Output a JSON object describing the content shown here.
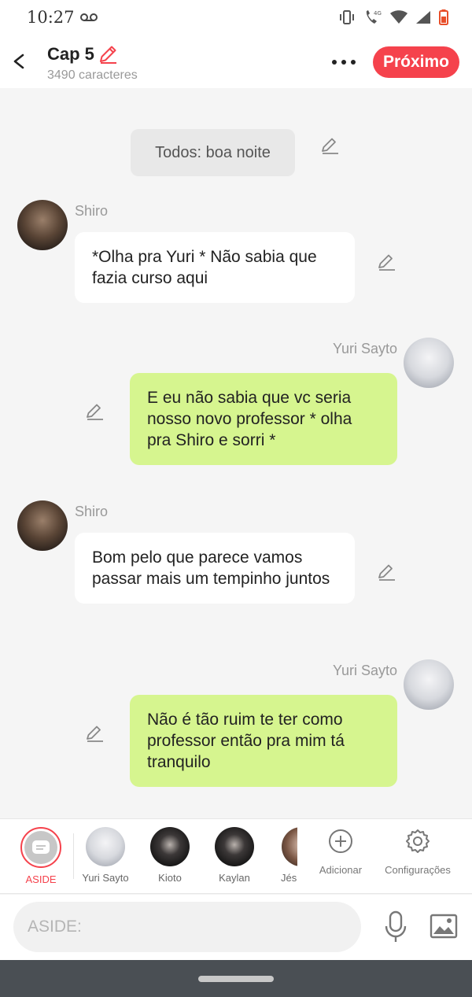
{
  "status_bar": {
    "time": "10:27",
    "network": "4G"
  },
  "header": {
    "title": "Cap 5",
    "char_count": "3490 caracteres",
    "next_label": "Próximo"
  },
  "messages": [
    {
      "type": "aside",
      "text": "Todos: boa noite"
    },
    {
      "type": "left",
      "sender": "Shiro",
      "text": "*Olha pra Yuri * Não sabia que fazia curso aqui"
    },
    {
      "type": "right",
      "sender": "Yuri Sayto",
      "text": "E eu não sabia que vc seria nosso novo professor * olha pra Shiro e sorri *"
    },
    {
      "type": "left",
      "sender": "Shiro",
      "text": "Bom pelo que parece vamos passar mais um tempinho juntos"
    },
    {
      "type": "right",
      "sender": "Yuri Sayto",
      "text": "Não é tão ruim te ter como professor então pra mim tá tranquilo"
    }
  ],
  "characters": [
    {
      "label": "ASIDE",
      "selected": true
    },
    {
      "label": "Yuri Sayto"
    },
    {
      "label": "Kioto"
    },
    {
      "label": "Kaylan"
    },
    {
      "label": "Jés"
    }
  ],
  "tools": {
    "add_label": "Adicionar",
    "settings_label": "Configurações"
  },
  "input": {
    "placeholder": "ASIDE:"
  },
  "colors": {
    "accent": "#f5424c",
    "bubble_right": "#d6f58f",
    "bubble_left": "#ffffff",
    "background": "#f5f5f5"
  }
}
